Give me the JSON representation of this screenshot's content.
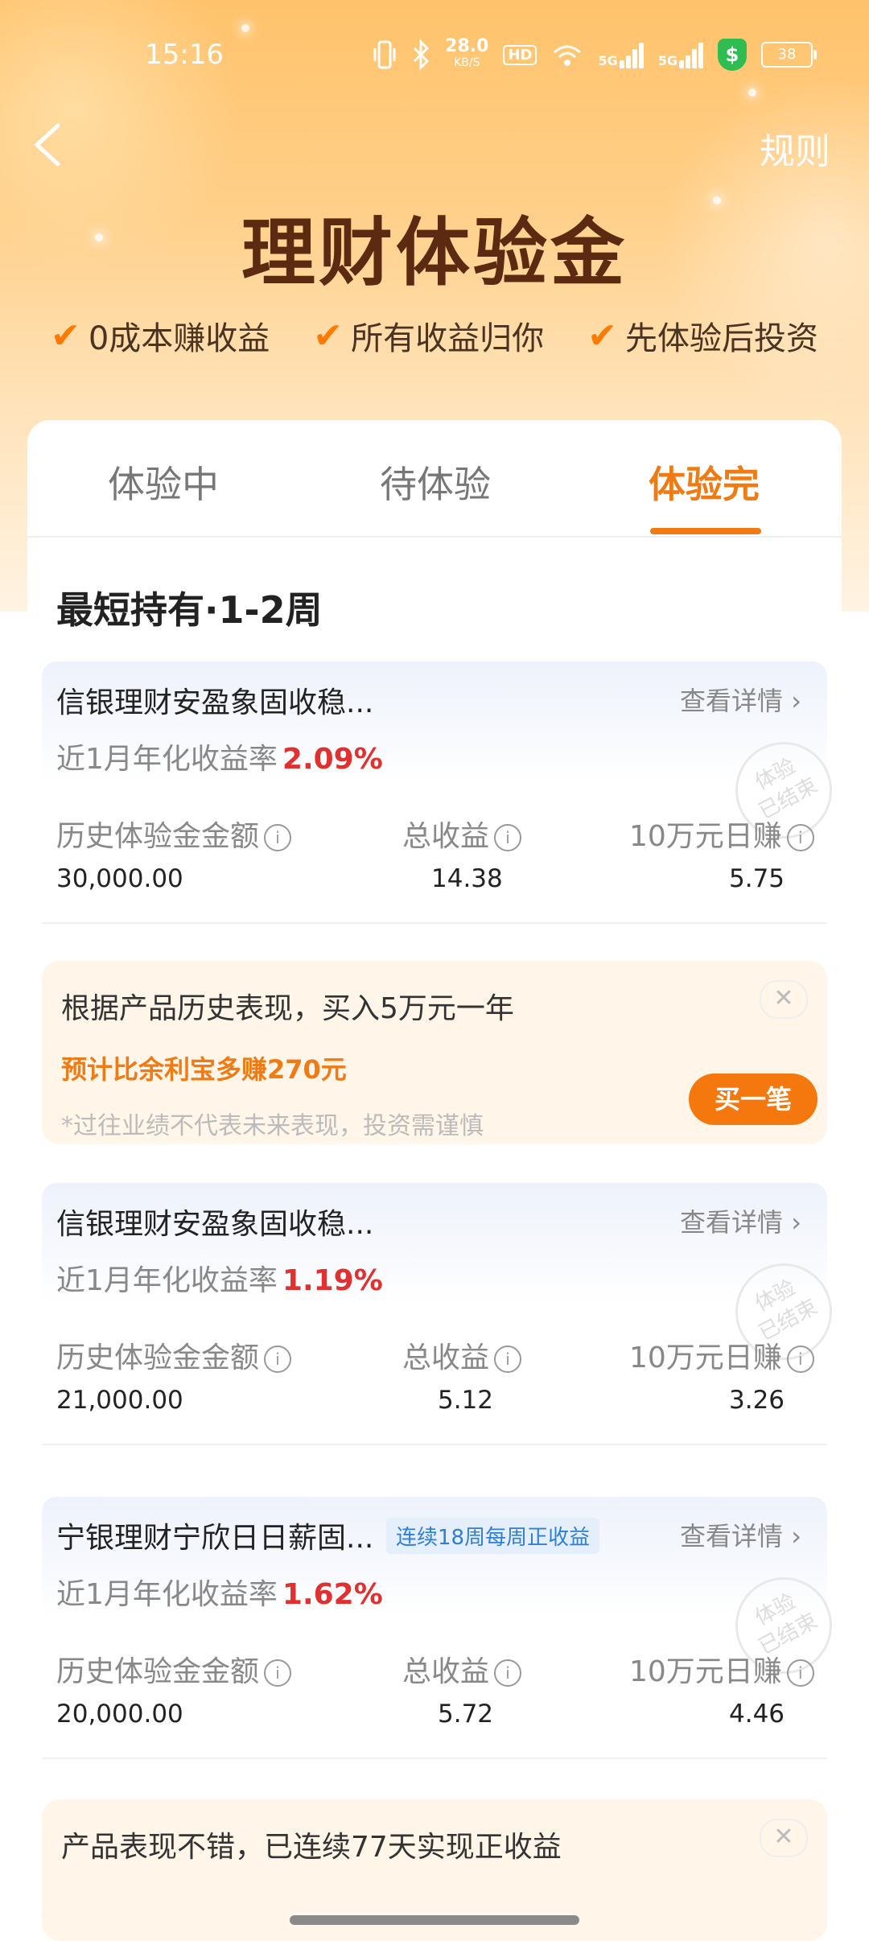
{
  "status_bar": {
    "time": "15:16",
    "net_speed": "28.0",
    "net_unit": "KB/S",
    "hd_label": "HD",
    "sig1": "5G",
    "sig2": "5G",
    "shield": "$",
    "battery": "38"
  },
  "header": {
    "rules_label": "规则",
    "title": "理财体验金",
    "features": [
      "0成本赚收益",
      "所有收益归你",
      "先体验后投资"
    ]
  },
  "tabs": [
    {
      "label": "体验中"
    },
    {
      "label": "待体验"
    },
    {
      "label": "体验完"
    }
  ],
  "active_tab": "体验完",
  "section_title": "最短持有·1-2周",
  "labels": {
    "detail": "查看详情 ›",
    "rate_prefix": "近1月年化收益率",
    "col1": "历史体验金金额",
    "col2": "总收益",
    "col3": "10万元日赚",
    "stamp_line1": "体验",
    "stamp_line2": "已结束"
  },
  "products": [
    {
      "name": "信银理财安盈象固收稳...",
      "tag": "",
      "rate": "2.09%",
      "amount": "30,000.00",
      "total": "14.38",
      "daily": "5.75"
    },
    {
      "name": "信银理财安盈象固收稳...",
      "tag": "",
      "rate": "1.19%",
      "amount": "21,000.00",
      "total": "5.12",
      "daily": "3.26"
    },
    {
      "name": "宁银理财宁欣日日薪固...",
      "tag": "连续18周每周正收益",
      "rate": "1.62%",
      "amount": "20,000.00",
      "total": "5.72",
      "daily": "4.46"
    }
  ],
  "promo1": {
    "text": "根据产品历史表现，买入5万元一年",
    "highlight": "预计比余利宝多赚270元",
    "note": "*过往业绩不代表未来表现，投资需谨慎",
    "button": "买一笔",
    "close": "✕"
  },
  "promo2": {
    "text": "产品表现不错，已连续77天实现正收益",
    "close": "✕"
  }
}
